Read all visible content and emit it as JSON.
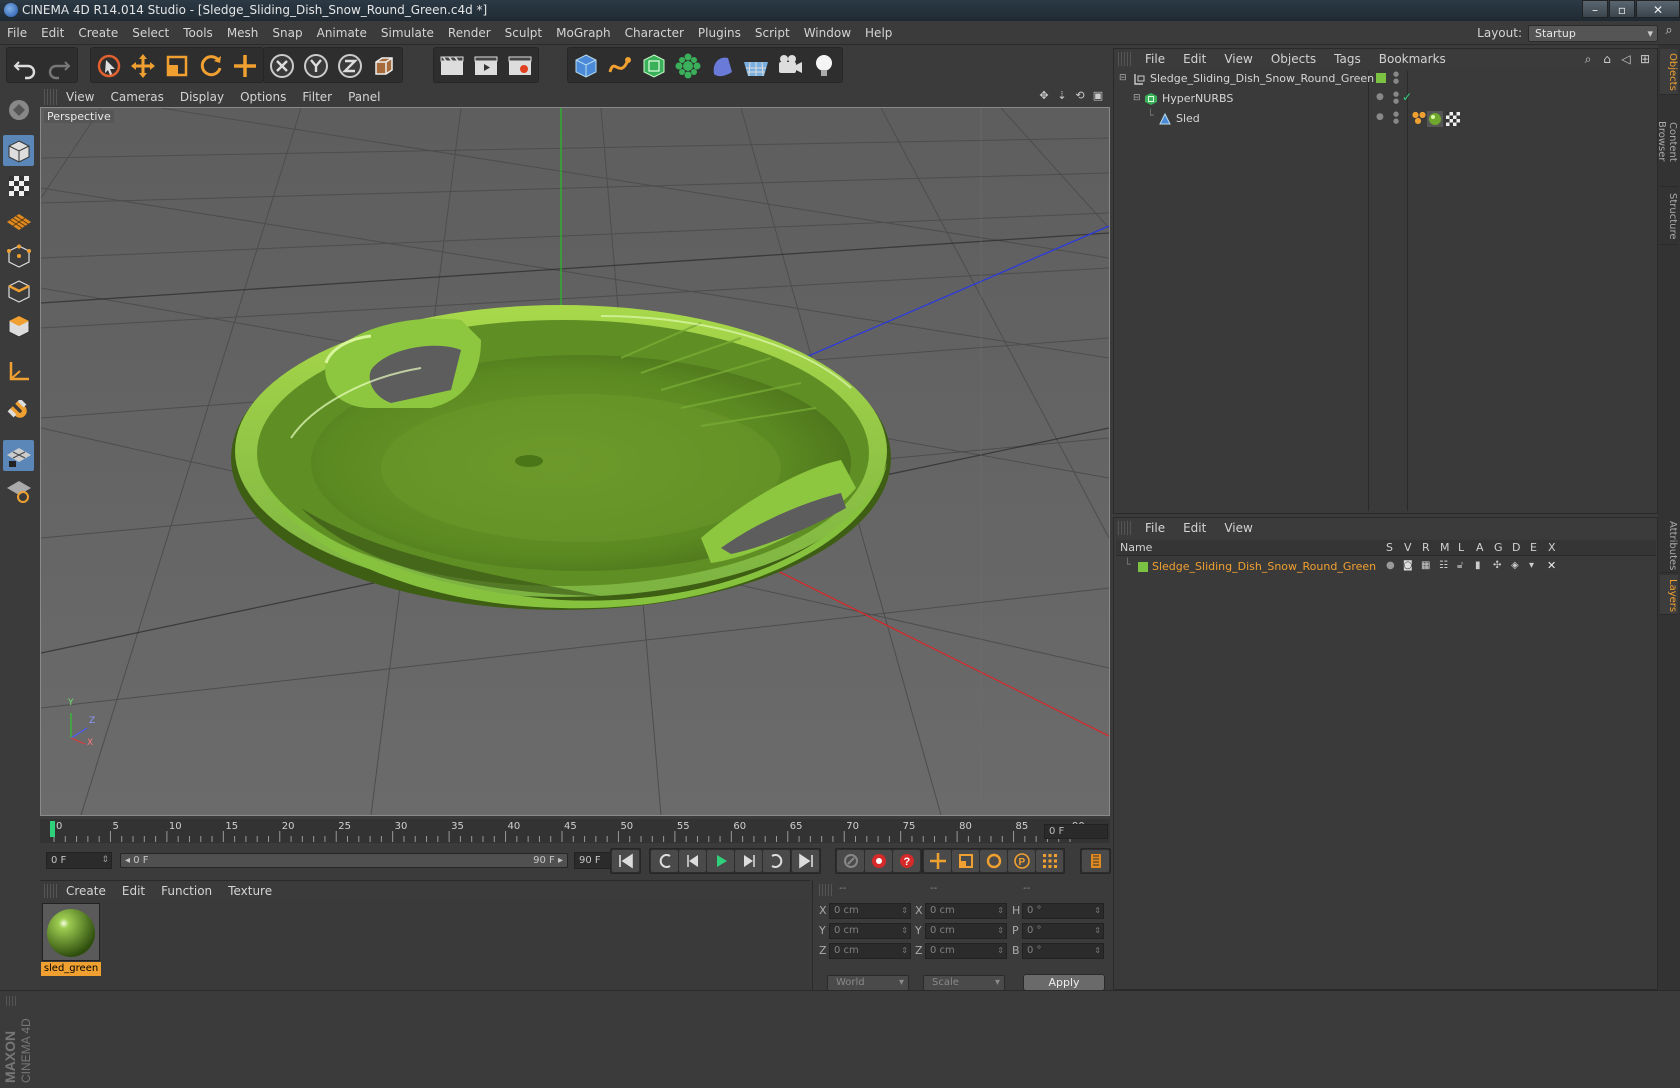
{
  "window": {
    "title": "CINEMA 4D R14.014 Studio - [Sledge_Sliding_Dish_Snow_Round_Green.c4d *]",
    "controls": [
      "–",
      "▫",
      "✕"
    ]
  },
  "menubar": {
    "items": [
      "File",
      "Edit",
      "Create",
      "Select",
      "Tools",
      "Mesh",
      "Snap",
      "Animate",
      "Simulate",
      "Render",
      "Sculpt",
      "MoGraph",
      "Character",
      "Plugins",
      "Script",
      "Window",
      "Help"
    ],
    "layout_label": "Layout:",
    "layout_value": "Startup"
  },
  "viewport": {
    "menu": [
      "View",
      "Cameras",
      "Display",
      "Options",
      "Filter",
      "Panel"
    ],
    "label": "Perspective",
    "axes": {
      "y": "Y",
      "z": "Z",
      "x": "X"
    },
    "object_color": "#7cb342"
  },
  "timeline": {
    "ticks": [
      "0",
      "5",
      "10",
      "15",
      "20",
      "25",
      "30",
      "35",
      "40",
      "45",
      "50",
      "55",
      "60",
      "65",
      "70",
      "75",
      "80",
      "85",
      "90"
    ],
    "current_frame": "0 F"
  },
  "transport": {
    "start_field": "0 F",
    "slider_left": "◂ 0 F",
    "slider_right": "90 F ▸",
    "end_field": "90 F"
  },
  "material_manager": {
    "menu": [
      "Create",
      "Edit",
      "Function",
      "Texture"
    ],
    "material_name": "sled_green"
  },
  "coordinates": {
    "headers": [
      "--",
      "--",
      "--"
    ],
    "rows": [
      {
        "a": "X",
        "av": "0 cm",
        "b": "X",
        "bv": "0 cm",
        "c": "H",
        "cv": "0 °"
      },
      {
        "a": "Y",
        "av": "0 cm",
        "b": "Y",
        "bv": "0 cm",
        "c": "P",
        "cv": "0 °"
      },
      {
        "a": "Z",
        "av": "0 cm",
        "b": "Z",
        "bv": "0 cm",
        "c": "B",
        "cv": "0 °"
      }
    ],
    "space": "World",
    "mode": "Scale",
    "apply": "Apply"
  },
  "objects_panel": {
    "menu": [
      "File",
      "Edit",
      "View",
      "Objects",
      "Tags",
      "Bookmarks"
    ],
    "tree": [
      {
        "name": "Sledge_Sliding_Dish_Snow_Round_Green",
        "indent": 0
      },
      {
        "name": "HyperNURBS",
        "indent": 1
      },
      {
        "name": "Sled",
        "indent": 2
      }
    ]
  },
  "layers_panel": {
    "menu": [
      "File",
      "Edit",
      "View"
    ],
    "columns": {
      "name": "Name",
      "flags": [
        "S",
        "V",
        "R",
        "M",
        "L",
        "A",
        "G",
        "D",
        "E",
        "X"
      ]
    },
    "layer_name": "Sledge_Sliding_Dish_Snow_Round_Green",
    "layer_color": "#7cc242"
  },
  "side_tabs": [
    "Objects",
    "Content Browser",
    "Structure",
    "Attributes",
    "Layers"
  ],
  "brand": "MAXON CINEMA 4D"
}
